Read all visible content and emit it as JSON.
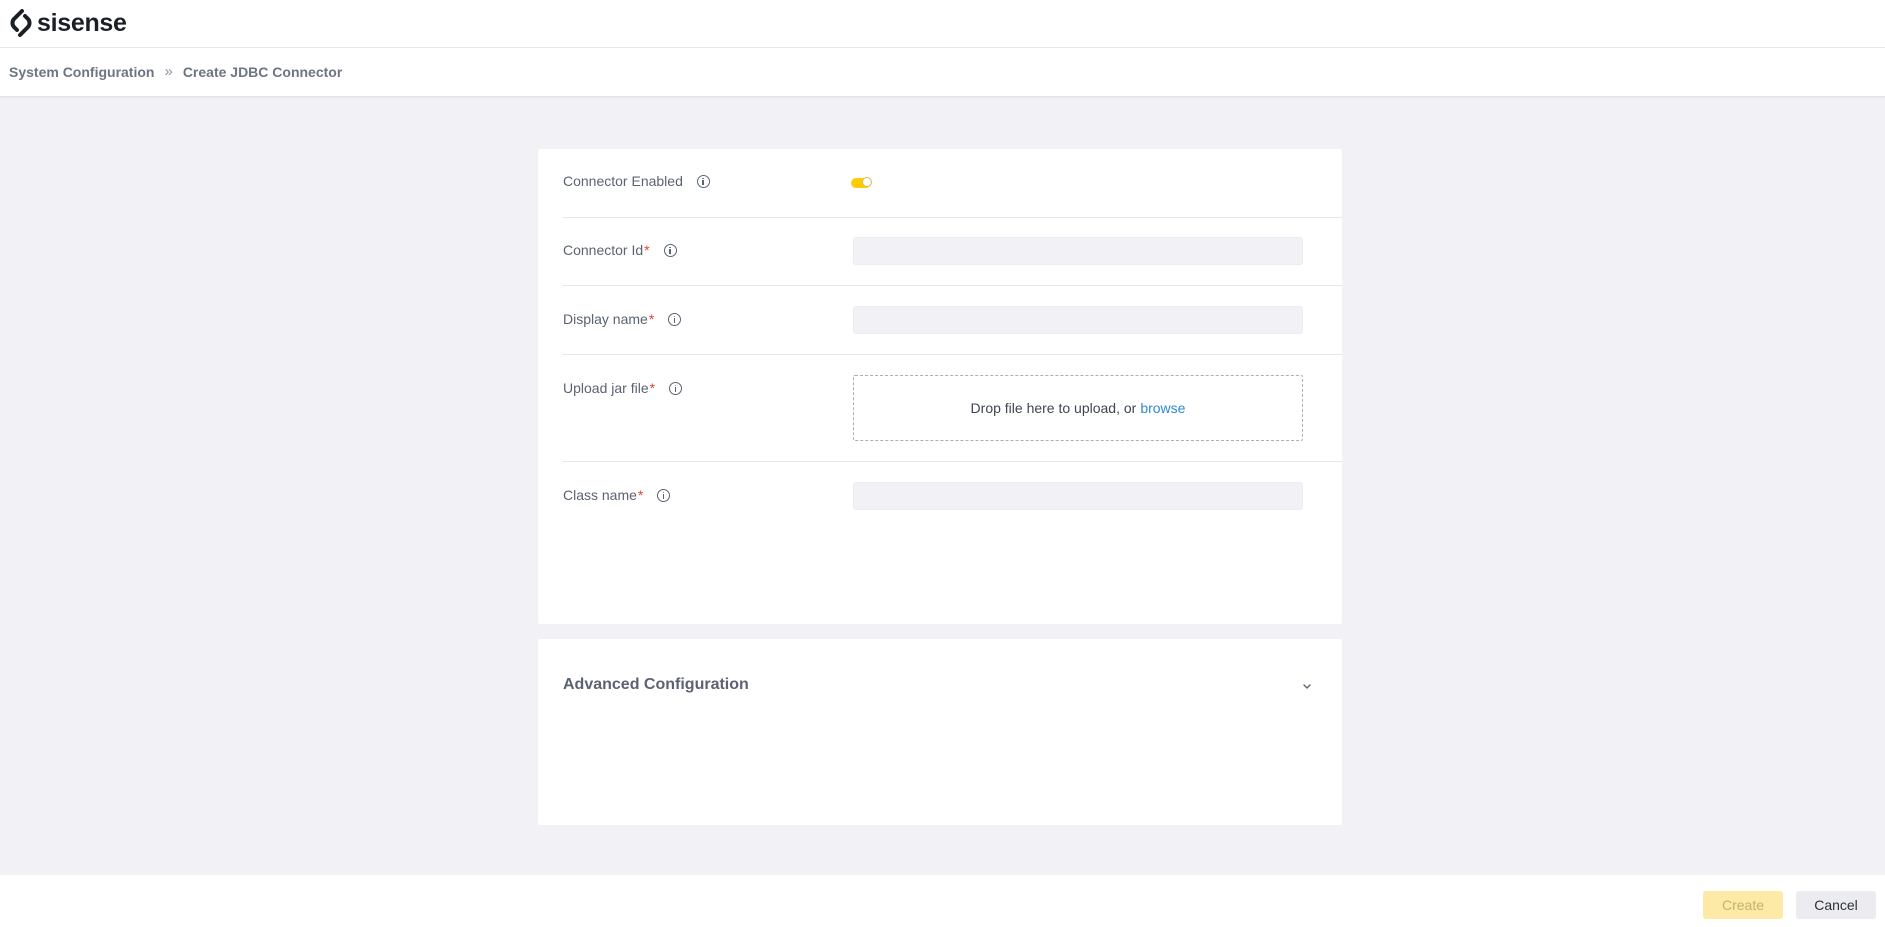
{
  "brand": {
    "name": "sisense",
    "accent": "#ffcb05"
  },
  "breadcrumb": {
    "items": [
      "System Configuration",
      "Create JDBC Connector"
    ],
    "separator": "»"
  },
  "form": {
    "connector_enabled": {
      "label": "Connector Enabled",
      "on": true
    },
    "connector_id": {
      "label": "Connector Id",
      "required_mark": "*",
      "value": ""
    },
    "display_name": {
      "label": "Display name",
      "required_mark": "*",
      "value": ""
    },
    "upload_jar": {
      "label": "Upload jar file",
      "required_mark": "*",
      "drop_text": "Drop file here to upload, or",
      "browse_label": "browse"
    },
    "class_name": {
      "label": "Class name",
      "required_mark": "*",
      "value": ""
    }
  },
  "advanced": {
    "title": "Advanced Configuration",
    "expanded": false
  },
  "footer": {
    "create_label": "Create",
    "cancel_label": "Cancel"
  }
}
